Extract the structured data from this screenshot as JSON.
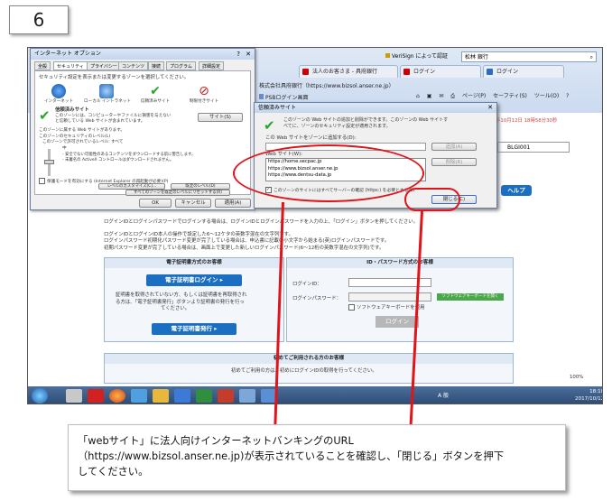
{
  "step": {
    "number": "6"
  },
  "browser": {
    "address": "VeriSign によって認証",
    "search_hint": "松林 銀行",
    "tabs": [
      {
        "label": "法人のお客さま - 具府銀行"
      },
      {
        "label": "ログイン"
      },
      {
        "label": "ログイン"
      }
    ],
    "owner_line": "株式会社具府銀行（https://www.bizsol.anser.ne.jp）",
    "favorite_label": "PSBログイン画面",
    "menu": [
      "ページ(P)",
      "セーフティ(S)",
      "ツール(O)",
      "?"
    ]
  },
  "page": {
    "date_text": "年10月12日 18時58分30秒",
    "session_code": "BLGI001",
    "help_label": "ヘルプ",
    "intro_lines": [
      "ログインIDとログインパスワードでログインする場合は、ログインIDとログインパスワードを入力の上、「ログイン」ボタンを押してください。",
      "ログインIDとログインID本人の操作で設定した6〜12ケタの英数字混在の文字列です。",
      "ログインパスワード初期化パスワード変更が完了している場合は、申込書に記載の小文字から始まる(英)ログインパスワードです。",
      "初期パスワード変更が完了している場合は、画面上で変更した新しいログインパスワード(6〜12桁の英数字混在の文字列)です。"
    ],
    "cert_panel": {
      "title": "電子証明書方式のお客様",
      "login_button": "電子証明書ログイン ▸",
      "desc_lines": [
        "証明書を取得されていない方、もしくは証明書を再取得され",
        "る方は、「電子証明書発行」ボタンより証明書の発行を行っ",
        "てください。"
      ],
      "issue_button": "電子証明書発行 ▸"
    },
    "id_panel": {
      "title": "ID・パスワード方式のお客様",
      "id_label": "ログインID：",
      "password_label": "ログインパスワード：",
      "software_keyboard": "ソフトウェアキーボードを使用",
      "green_button": "ソフトウェアキーボードを開く",
      "login_button": "ログイン"
    },
    "first_time": {
      "title": "初めてご利用される方のお客様",
      "desc": "初めてご利用の方は、初めにログインIDの取得を行ってください。"
    },
    "zoom": "100%"
  },
  "inet_dialog": {
    "title": "インターネット オプション",
    "tabs": [
      "全般",
      "セキュリティ",
      "プライバシー",
      "コンテンツ",
      "接続",
      "プログラム",
      "詳細設定"
    ],
    "instruction": "セキュリティ設定を表示または変更するゾーンを選択してください。",
    "zones": [
      "インターネット",
      "ローカル イントラネット",
      "信頼済みサイト",
      "制限付きサイト"
    ],
    "zone_title": "信頼済みサイト",
    "zone_desc_lines": [
      "このゾーンには、コンピューターやファイルに損害を与えない",
      "と信頼している Web サイトが含まれています。"
    ],
    "sites_button": "サイト(S)",
    "zone_has_sites": "このゾーンに属する Web サイトがあります。",
    "level_title": "このゾーンのセキュリティのレベル(L)",
    "level_sub": "このゾーンで許可されているレベル: すべて",
    "level_name": "中",
    "level_desc_lines": [
      "- 安全でない可能性のあるコンテンツをダウンロードする前に警告します。",
      "- 未署名の ActiveX コントロールはダウンロードされません。"
    ],
    "protected_mode": "保護モードを有効にする (Internet Explorer の再起動が必要)(P)",
    "custom_level": "レベルのカスタマイズ(C)...",
    "default_level": "既定のレベル(D)",
    "reset_all": "すべてのゾーンを既定のレベルにリセットする(R)",
    "ok": "OK",
    "cancel": "キャンセル",
    "apply": "適用(A)"
  },
  "trusted_dialog": {
    "title": "信頼済みサイト",
    "desc_lines": [
      "このゾーンの Web サイトの追加と削除ができます。このゾーンの Web サイトす",
      "べてに、ゾーンのセキュリティ設定が適用されます。"
    ],
    "add_label": "この Web サイトをゾーンに追加する(D):",
    "add_button": "追加(A)",
    "list_label": "Web サイト(W):",
    "sites": [
      "https://home.secpac.jp",
      "https://www.bizsol.anser.ne.jp",
      "https://www.dentsu-data.jp"
    ],
    "remove_button": "削除(R)",
    "https_check": "このゾーンのサイトにはすべてサーバーの確認 (https:) を必要とする(S)",
    "close_button": "閉じる(C)"
  },
  "taskbar": {
    "ime": "A 般",
    "time": "18:18",
    "date": "2017/10/12"
  },
  "callout": {
    "lines": [
      "「webサイト」に法人向けインターネットバンキングのURL",
      "（https://www.bizsol.anser.ne.jp)が表示されていることを確認し、「閉じる」ボタンを押下",
      "してください。"
    ]
  }
}
